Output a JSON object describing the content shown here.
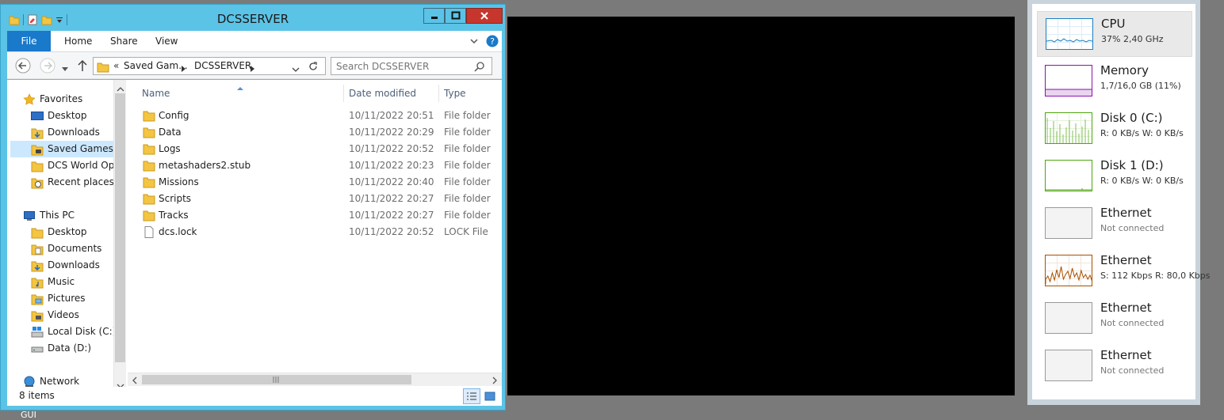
{
  "window": {
    "title": "DCSSERVER",
    "controls": {
      "minimize": "minimize",
      "maximize": "maximize",
      "close": "close"
    }
  },
  "ribbon": {
    "tabs": [
      "File",
      "Home",
      "Share",
      "View"
    ]
  },
  "address": {
    "prefix": "«",
    "crumbs": [
      "Saved Gam...",
      "DCSSERVER"
    ],
    "search_placeholder": "Search DCSSERVER"
  },
  "nav": {
    "favorites_label": "Favorites",
    "favorites": [
      "Desktop",
      "Downloads",
      "Saved Games",
      "DCS World Ope",
      "Recent places"
    ],
    "this_pc_label": "This PC",
    "this_pc": [
      "Desktop",
      "Documents",
      "Downloads",
      "Music",
      "Pictures",
      "Videos",
      "Local Disk (C:)",
      "Data (D:)"
    ],
    "network_label": "Network"
  },
  "columns": {
    "name": "Name",
    "date": "Date modified",
    "type": "Type"
  },
  "files": [
    {
      "name": "Config",
      "date": "10/11/2022 20:51",
      "type": "File folder",
      "kind": "folder"
    },
    {
      "name": "Data",
      "date": "10/11/2022 20:29",
      "type": "File folder",
      "kind": "folder"
    },
    {
      "name": "Logs",
      "date": "10/11/2022 20:52",
      "type": "File folder",
      "kind": "folder"
    },
    {
      "name": "metashaders2.stub",
      "date": "10/11/2022 20:23",
      "type": "File folder",
      "kind": "folder"
    },
    {
      "name": "Missions",
      "date": "10/11/2022 20:40",
      "type": "File folder",
      "kind": "folder"
    },
    {
      "name": "Scripts",
      "date": "10/11/2022 20:27",
      "type": "File folder",
      "kind": "folder"
    },
    {
      "name": "Tracks",
      "date": "10/11/2022 20:27",
      "type": "File folder",
      "kind": "folder"
    },
    {
      "name": "dcs.lock",
      "date": "10/11/2022 20:52",
      "type": "LOCK File",
      "kind": "file"
    }
  ],
  "status": {
    "items": "8 items"
  },
  "desktop_icon_label": "GUI",
  "perf": [
    {
      "title": "CPU",
      "sub": "37% 2,40 GHz",
      "color": "#1a7fc1"
    },
    {
      "title": "Memory",
      "sub": "1,7/16,0 GB (11%)",
      "color": "#8b12ae"
    },
    {
      "title": "Disk 0 (C:)",
      "sub": "R: 0 KB/s  W: 0 KB/s",
      "color": "#4da60c"
    },
    {
      "title": "Disk 1 (D:)",
      "sub": "R: 0 KB/s  W: 0 KB/s",
      "color": "#4da60c"
    },
    {
      "title": "Ethernet",
      "sub": "Not connected",
      "color": "#999999"
    },
    {
      "title": "Ethernet",
      "sub": "S: 112 Kbps  R: 80,0 Kbps",
      "color": "#a74f01"
    },
    {
      "title": "Ethernet",
      "sub": "Not connected",
      "color": "#999999"
    },
    {
      "title": "Ethernet",
      "sub": "Not connected",
      "color": "#999999"
    }
  ]
}
